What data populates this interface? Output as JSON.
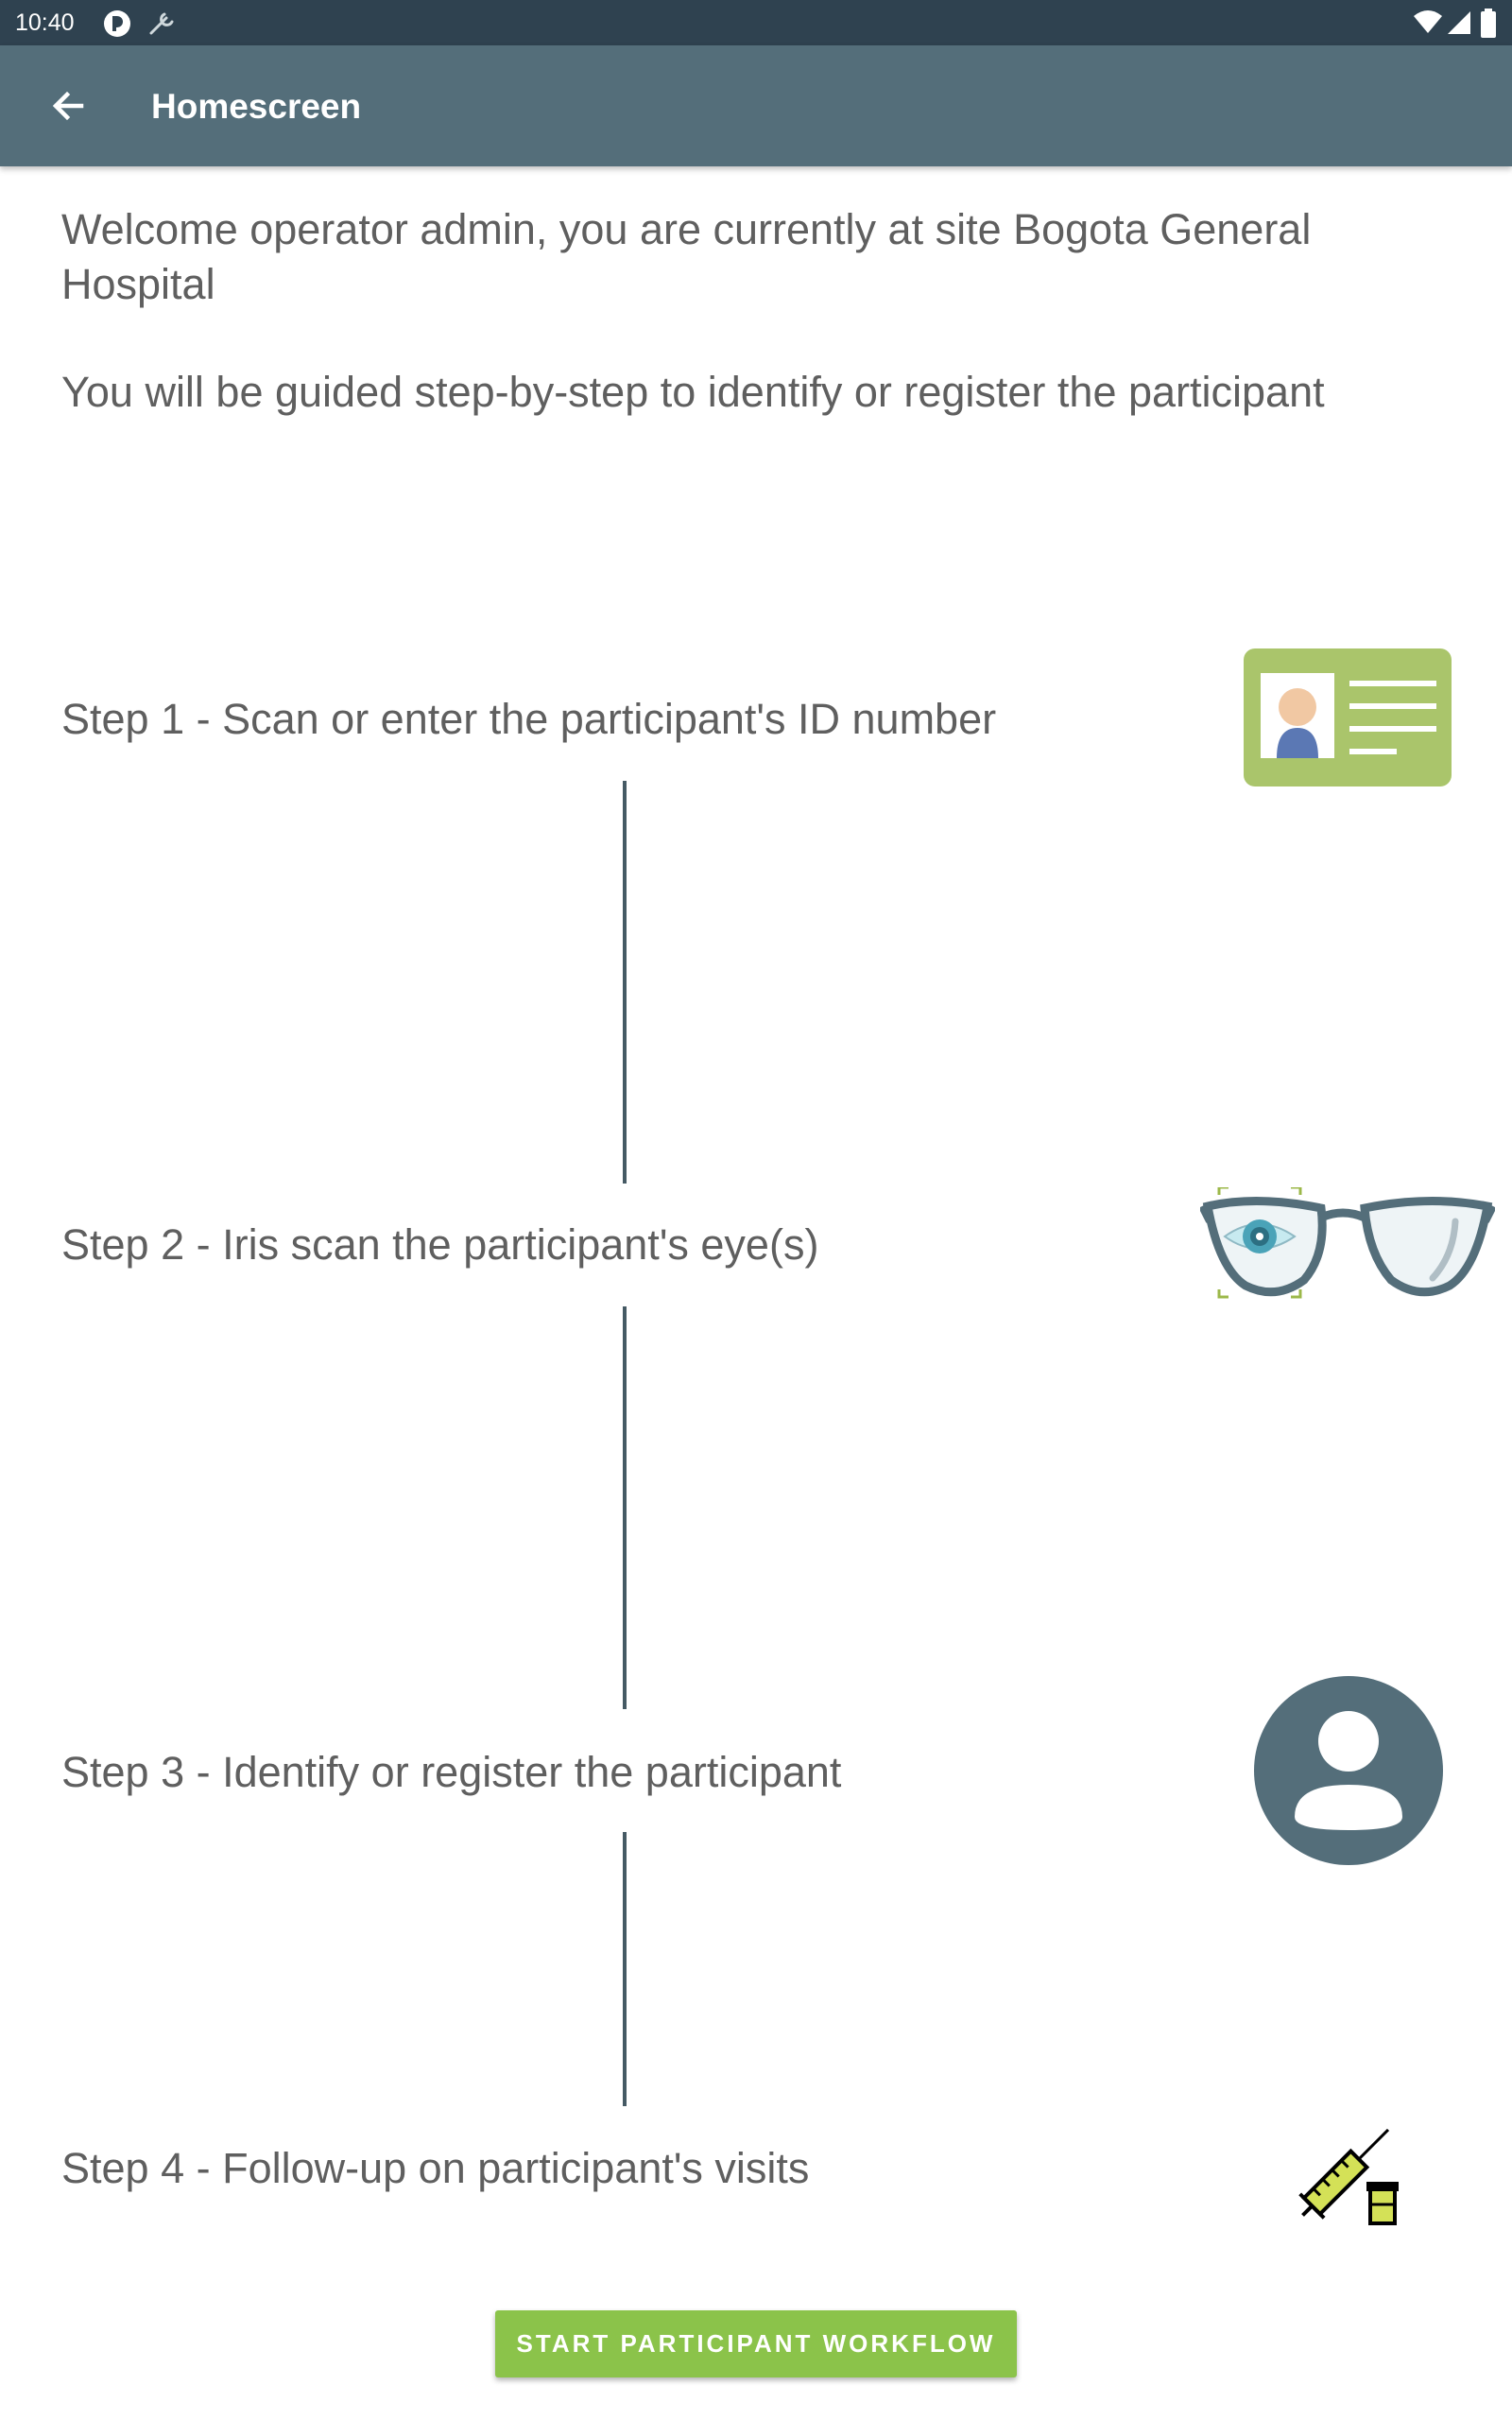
{
  "status_bar": {
    "time": "10:40",
    "icons": [
      "sync-icon",
      "wrench-icon",
      "wifi-icon",
      "signal-icon",
      "battery-icon"
    ]
  },
  "app_bar": {
    "back_icon": "arrow-back-icon",
    "title": "Homescreen"
  },
  "main": {
    "welcome": "Welcome operator admin, you are currently at site Bogota General Hospital",
    "guide": "You will be guided step-by-step to identify or register the participant",
    "steps": [
      {
        "label": "Step 1 - Scan or enter the participant's ID number",
        "icon": "id-card-icon"
      },
      {
        "label": "Step 2 - Iris scan the participant's eye(s)",
        "icon": "glasses-iris-icon"
      },
      {
        "label": "Step 3 - Identify or register the participant",
        "icon": "account-circle-icon"
      },
      {
        "label": "Step 4 - Follow-up on participant's visits",
        "icon": "syringe-vial-icon"
      }
    ],
    "start_button": "START PARTICIPANT WORKFLOW"
  },
  "colors": {
    "status_bar": "#2f4250",
    "app_bar": "#546e7a",
    "accent": "#8bc34a",
    "connector": "#455a64",
    "text": "#5f5f5f"
  }
}
